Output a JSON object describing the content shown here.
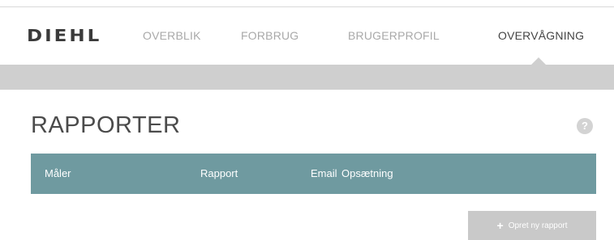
{
  "brand": {
    "logo_text": "DIEHL"
  },
  "nav": {
    "items": [
      {
        "label": "OVERBLIK",
        "active": false
      },
      {
        "label": "FORBRUG",
        "active": false
      },
      {
        "label": "BRUGERPROFIL",
        "active": false
      },
      {
        "label": "OVERVÅGNING",
        "active": true
      }
    ]
  },
  "page": {
    "title": "RAPPORTER",
    "help_icon": "?"
  },
  "table": {
    "columns": [
      "Måler",
      "Rapport",
      "Email",
      "Opsætning"
    ],
    "header_color": "#6f9aa0"
  },
  "actions": {
    "new_report_icon": "+",
    "new_report_label": "Opret ny rapport"
  }
}
